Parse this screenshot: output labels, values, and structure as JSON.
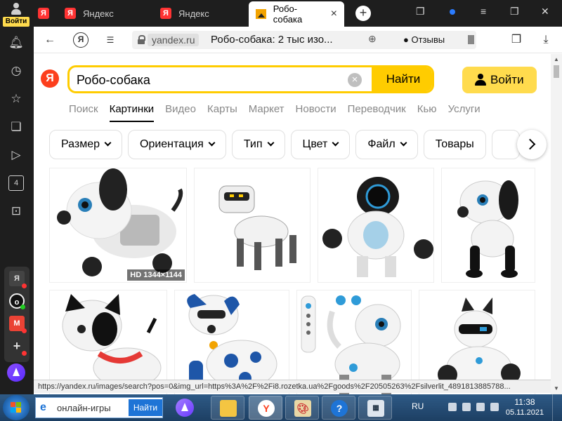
{
  "browser": {
    "profile_login": "Войти",
    "tabs": [
      {
        "label": "Яндекс"
      },
      {
        "label": "Яндекс"
      },
      {
        "label": "Робо-собака"
      }
    ],
    "address": {
      "domain": "yandex.ru",
      "title": "Робо-собака: 2 тыс изо...",
      "reviews": "Отзывы"
    },
    "sidebar_badge": "4",
    "status_url": "https://yandex.ru/images/search?pos=0&img_url=https%3A%2F%2Fi8.rozetka.ua%2Fgoods%2F20505263%2Fsilverlit_4891813885788..."
  },
  "yandex": {
    "logo": "Я",
    "search": {
      "query": "Робо-собака",
      "button": "Найти"
    },
    "login_button": "Войти",
    "services": [
      "Поиск",
      "Картинки",
      "Видео",
      "Карты",
      "Маркет",
      "Новости",
      "Переводчик",
      "Кью",
      "Услуги"
    ],
    "filters": [
      {
        "label": "Размер"
      },
      {
        "label": "Ориентация"
      },
      {
        "label": "Тип"
      },
      {
        "label": "Цвет"
      },
      {
        "label": "Файл"
      },
      {
        "label": "Товары"
      }
    ],
    "hd_badge": "HD 1344×1144"
  },
  "taskbar": {
    "search_text": "онлайн-игры",
    "search_button": "Найти",
    "language": "RU",
    "time": "11:38",
    "date": "05.11.2021"
  },
  "colors": {
    "accent": "#ffcc00",
    "yandex_red": "#fc3f1d",
    "chrome_dark": "#1e1e1e"
  }
}
